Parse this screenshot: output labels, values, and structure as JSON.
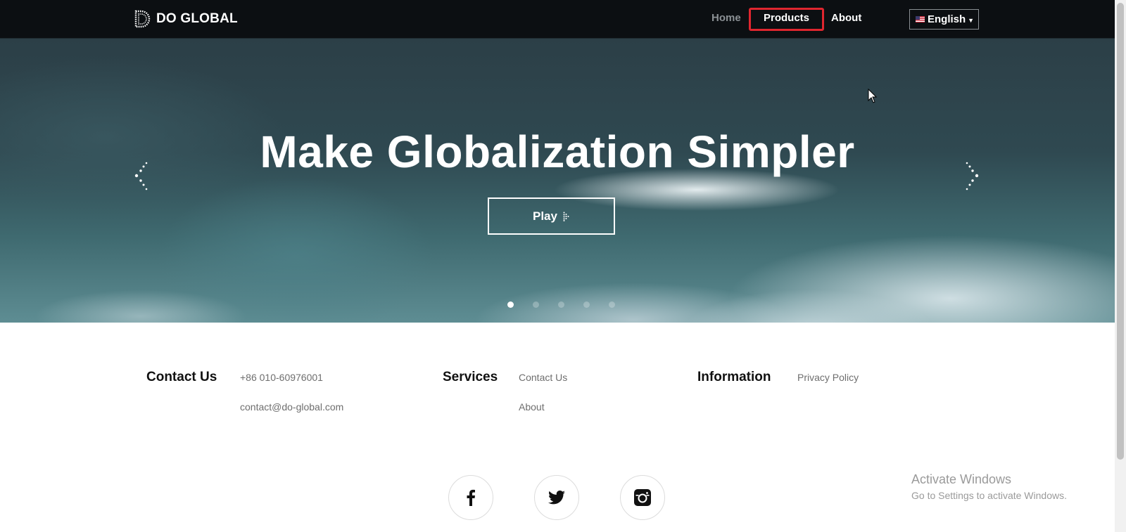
{
  "header": {
    "logo_text": "DO GLOBAL",
    "nav": {
      "home": "Home",
      "products": "Products",
      "about": "About"
    },
    "language": "English"
  },
  "hero": {
    "title": "Make Globalization Simpler",
    "play_label": "Play",
    "slide_count": 5,
    "active_slide": 1
  },
  "footer": {
    "contact": {
      "title": "Contact Us",
      "phone": "+86 010-60976001",
      "email": "contact@do-global.com"
    },
    "services": {
      "title": "Services",
      "links": [
        "Contact Us",
        "About"
      ]
    },
    "information": {
      "title": "Information",
      "links": [
        "Privacy Policy"
      ]
    },
    "social": [
      "facebook-icon",
      "twitter-icon",
      "instagram-icon"
    ]
  },
  "windows_watermark": {
    "title": "Activate Windows",
    "subtitle": "Go to Settings to activate Windows."
  },
  "colors": {
    "highlight": "#e0262f",
    "header_bg": "#0c0f12"
  }
}
